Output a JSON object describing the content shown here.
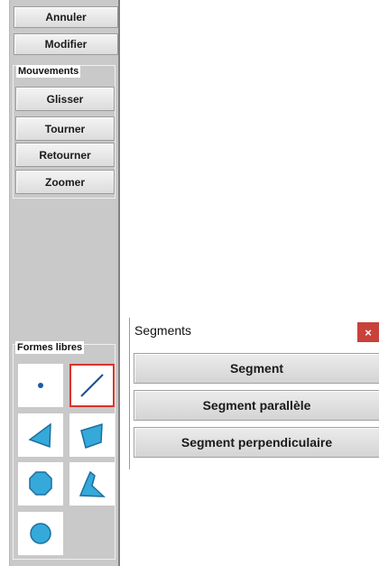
{
  "toolbar": {
    "undo_label": "Annuler",
    "modify_label": "Modifier"
  },
  "movements": {
    "title": "Mouvements",
    "buttons": [
      "Glisser",
      "Tourner",
      "Retourner",
      "Zoomer"
    ]
  },
  "free_shapes": {
    "title": "Formes libres",
    "shapes": [
      {
        "icon": "point-icon",
        "selected": false
      },
      {
        "icon": "segment-line-icon",
        "selected": true
      },
      {
        "icon": "triangle-icon",
        "selected": false
      },
      {
        "icon": "quadrilateral-icon",
        "selected": false
      },
      {
        "icon": "octagon-icon",
        "selected": false
      },
      {
        "icon": "concave-polygon-icon",
        "selected": false
      },
      {
        "icon": "circle-icon",
        "selected": false
      }
    ]
  },
  "segments_popup": {
    "title": "Segments",
    "close_glyph": "×",
    "buttons": [
      "Segment",
      "Segment parallèle",
      "Segment perpendiculaire"
    ]
  },
  "colors": {
    "shape_fill": "#35a9d9",
    "shape_stroke": "#1b6fa0",
    "selected_border": "#d9342b",
    "close_button": "#c8413a",
    "panel_bg": "#c9c9c9"
  }
}
